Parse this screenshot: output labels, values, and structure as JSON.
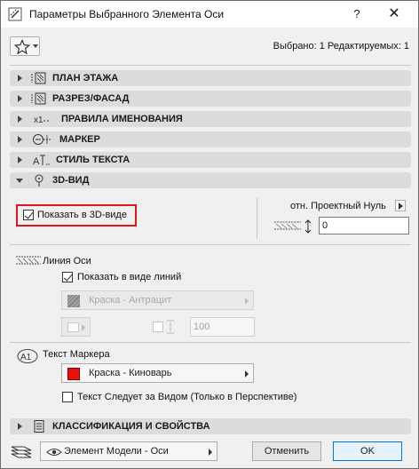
{
  "window": {
    "title": "Параметры Выбранного Элемента Оси",
    "help_label": "?",
    "close_label": "✕"
  },
  "header": {
    "selection_info": "Выбрано: 1 Редактируемых: 1",
    "favorites_icon": "star-icon"
  },
  "panels": [
    {
      "label": "ПЛАН ЭТАЖА",
      "icon": "floor-plan-icon",
      "open": false
    },
    {
      "label": "РАЗРЕЗ/ФАСАД",
      "icon": "section-elevation-icon",
      "open": false
    },
    {
      "label": "ПРАВИЛА ИМЕНОВАНИЯ",
      "icon": "naming-rules-icon",
      "open": false
    },
    {
      "label": "МАРКЕР",
      "icon": "marker-icon",
      "open": false
    },
    {
      "label": "СТИЛЬ ТЕКСТА",
      "icon": "text-style-icon",
      "open": false
    },
    {
      "label": "3D-ВИД",
      "icon": "3d-view-icon",
      "open": true
    }
  ],
  "view3d": {
    "show_in_3d_label": "Показать в 3D-виде",
    "show_in_3d_checked": true,
    "reference_label": "отн. Проектный Нуль",
    "elevation_value": "0",
    "axis_line_label": "Линия Оси",
    "show_as_lines_label": "Показать в виде линий",
    "show_as_lines_checked": true,
    "line_paint": "Краска - Антрацит",
    "line_thickness_value": "100",
    "marker_text_label": "Текст Маркера",
    "marker_paint": "Краска - Киноварь",
    "marker_paint_color": "#e8120c",
    "follow_view_label": "Текст Следует за Видом (Только в Перспективе)",
    "follow_view_checked": false
  },
  "classification_panel": {
    "label": "КЛАССИФИКАЦИЯ И СВОЙСТВА",
    "icon": "classification-icon"
  },
  "footer": {
    "layer_value": "Элемент Модели - Оси",
    "cancel_label": "Отменить",
    "ok_label": "OK"
  }
}
